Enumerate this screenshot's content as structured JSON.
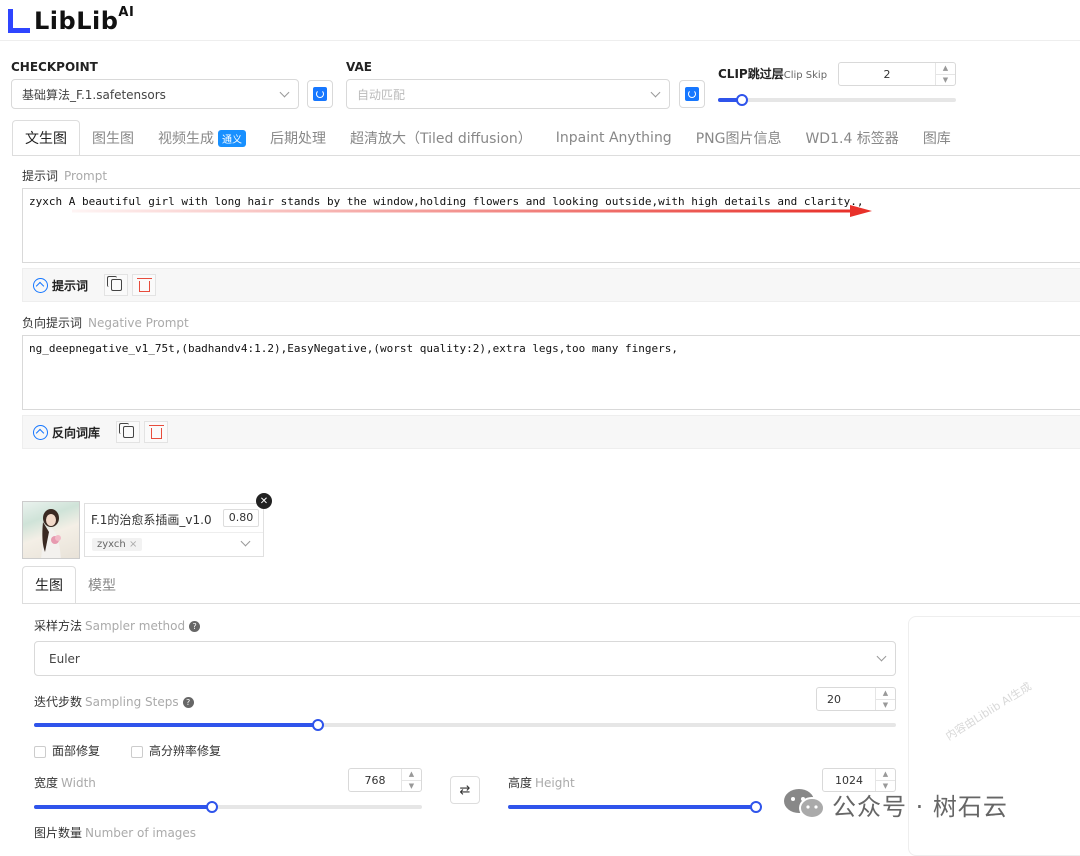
{
  "brand": {
    "name": "LibLib",
    "suffix": "AI"
  },
  "checkpoint": {
    "label": "CHECKPOINT",
    "value": "基础算法_F.1.safetensors"
  },
  "vae": {
    "label": "VAE",
    "value": "自动匹配"
  },
  "clip": {
    "label": "CLIP跳过层",
    "label_en": "Clip Skip",
    "value": "2",
    "level": 0.1
  },
  "tabs": [
    {
      "label": "文生图"
    },
    {
      "label": "图生图"
    },
    {
      "label": "视频生成",
      "badge": "通义"
    },
    {
      "label": "后期处理"
    },
    {
      "label": "超清放大（Tiled diffusion）"
    },
    {
      "label": "Inpaint Anything"
    },
    {
      "label": "PNG图片信息"
    },
    {
      "label": "WD1.4 标签器"
    },
    {
      "label": "图库"
    }
  ],
  "prompt": {
    "label": "提示词",
    "label_en": "Prompt",
    "text": "zyxch A beautiful girl with long hair stands by the window,holding flowers and looking outside,with high details and clarity.,",
    "toolbar_label": "提示词"
  },
  "negative": {
    "label": "负向提示词",
    "label_en": "Negative Prompt",
    "text": "ng_deepnegative_v1_75t,(badhandv4:1.2),EasyNegative,(worst quality:2),extra legs,too many fingers,",
    "toolbar_label": "反向词库"
  },
  "lora": {
    "name": "F.1的治愈系插画_v1.0",
    "weight": "0.80",
    "trigger": "zyxch"
  },
  "subtabs": [
    {
      "label": "生图"
    },
    {
      "label": "模型"
    }
  ],
  "sampler": {
    "label": "采样方法",
    "label_en": "Sampler method",
    "value": "Euler"
  },
  "steps": {
    "label": "迭代步数",
    "label_en": "Sampling Steps",
    "value": "20",
    "level": 0.33
  },
  "options": {
    "face_fix": "面部修复",
    "hires_fix": "高分辨率修复"
  },
  "width": {
    "label": "宽度",
    "label_en": "Width",
    "value": "768",
    "level": 0.46
  },
  "height": {
    "label": "高度",
    "label_en": "Height",
    "value": "1024",
    "level": 0.99
  },
  "batch": {
    "label": "图片数量",
    "label_en": "Number of images"
  },
  "watermark": "内容由Liblib AI生成",
  "overlay": {
    "wechat_text": "公众号 · 树石云"
  },
  "colors": {
    "accent": "#2f54eb",
    "badge": "#1890ff",
    "annotation_arrow": "#e8312a"
  }
}
